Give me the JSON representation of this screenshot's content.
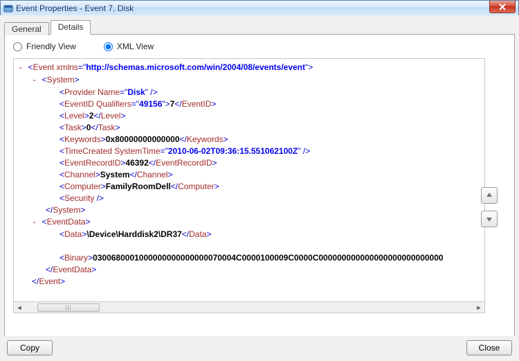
{
  "window": {
    "title": "Event Properties - Event 7, Disk"
  },
  "tabs": {
    "general": "General",
    "details": "Details"
  },
  "view": {
    "friendly": "Friendly View",
    "xml": "XML View"
  },
  "buttons": {
    "copy": "Copy",
    "close": "Close"
  },
  "xml": {
    "root_elem": "Event",
    "root_ns_attr": "xmlns",
    "root_ns_val": "http://schemas.microsoft.com/win/2004/08/events/event",
    "system_elem": "System",
    "provider_elem": "Provider",
    "provider_attr": "Name",
    "provider_val": "Disk",
    "eventid_elem": "EventID",
    "eventid_attr": "Qualifiers",
    "eventid_attrval": "49156",
    "eventid_text": "7",
    "level_elem": "Level",
    "level_text": "2",
    "task_elem": "Task",
    "task_text": "0",
    "keywords_elem": "Keywords",
    "keywords_text": "0x80000000000000",
    "timecreated_elem": "TimeCreated",
    "timecreated_attr": "SystemTime",
    "timecreated_val": "2010-06-02T09:36:15.551062100Z",
    "eventrecid_elem": "EventRecordID",
    "eventrecid_text": "46392",
    "channel_elem": "Channel",
    "channel_text": "System",
    "computer_elem": "Computer",
    "computer_text": "FamilyRoomDell",
    "security_elem": "Security",
    "eventdata_elem": "EventData",
    "data_elem": "Data",
    "data_text": "\\Device\\Harddisk2\\DR37",
    "binary_elem": "Binary",
    "binary_text": "0300680001000000000000000070004C0000100009C0000C000000000000000000000000000"
  }
}
